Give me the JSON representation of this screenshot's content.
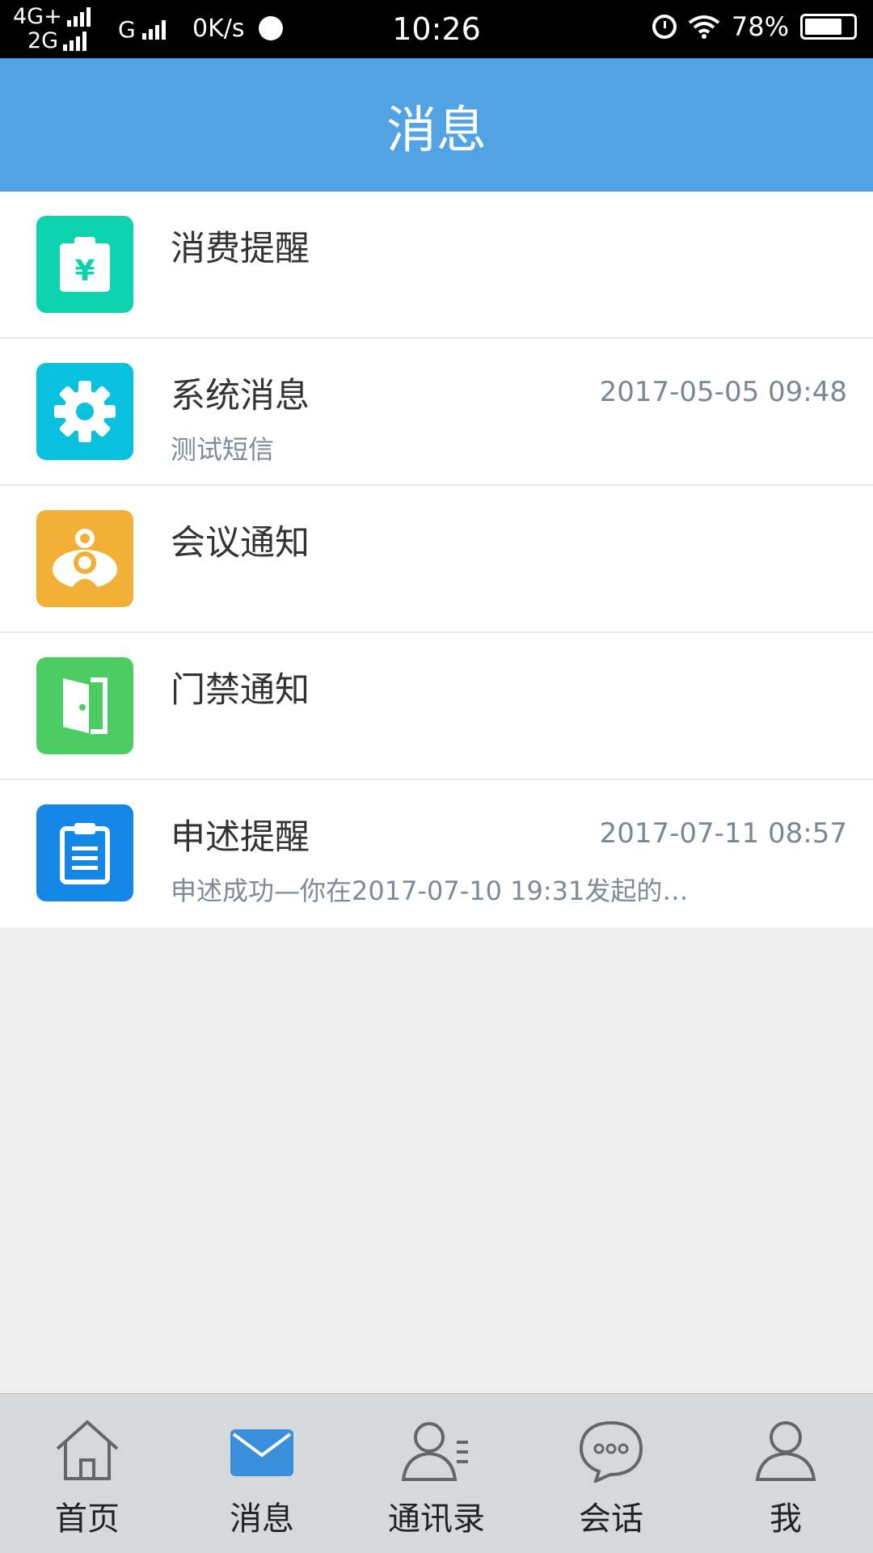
{
  "status_bar": {
    "network_top": "4G+",
    "network_bottom": "2G",
    "carrier_g": "G",
    "speed": "0K/s",
    "time": "10:26",
    "battery": "78%",
    "battery_level": 0.78
  },
  "header": {
    "title": "消息"
  },
  "messages": [
    {
      "title": "消费提醒",
      "time": "",
      "preview": "",
      "icon": "yuan-clipboard-icon",
      "color": "#0cd3ae"
    },
    {
      "title": "系统消息",
      "time": "2017-05-05 09:48",
      "preview": "测试短信",
      "icon": "gear-icon",
      "color": "#07c1df"
    },
    {
      "title": "会议通知",
      "time": "",
      "preview": "",
      "icon": "meeting-icon",
      "color": "#f3b037"
    },
    {
      "title": "门禁通知",
      "time": "",
      "preview": "",
      "icon": "door-icon",
      "color": "#4ccd63"
    },
    {
      "title": "申述提醒",
      "time": "2017-07-11 08:57",
      "preview": " 申述成功—你在2017-07-10 19:31发起的…",
      "icon": "clipboard-list-icon",
      "color": "#1386e6"
    }
  ],
  "bottom_nav": [
    {
      "label": "首页",
      "icon": "home-icon",
      "active": false
    },
    {
      "label": "消息",
      "icon": "mail-icon",
      "active": true
    },
    {
      "label": "通讯录",
      "icon": "contacts-icon",
      "active": false
    },
    {
      "label": "会话",
      "icon": "chat-icon",
      "active": false
    },
    {
      "label": "我",
      "icon": "user-icon",
      "active": false
    }
  ],
  "colors": {
    "header": "#52a3e4",
    "nav_active": "#3a8fdc",
    "nav_inactive": "#666666"
  }
}
